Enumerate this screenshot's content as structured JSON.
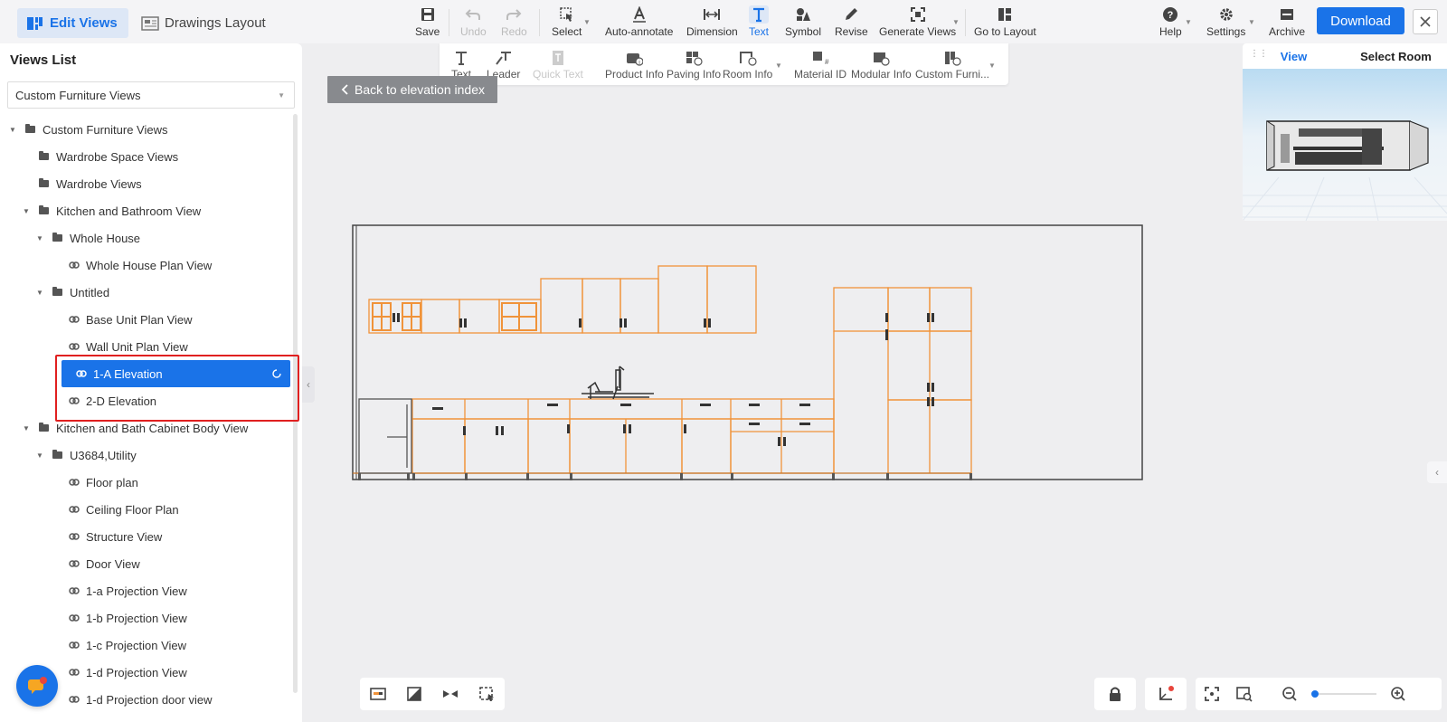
{
  "modes": [
    {
      "label": "Edit Views",
      "active": true
    },
    {
      "label": "Drawings Layout",
      "active": false
    }
  ],
  "toolbar": {
    "save": "Save",
    "undo": "Undo",
    "redo": "Redo",
    "select": "Select",
    "auto_annotate": "Auto-annotate",
    "dimension": "Dimension",
    "text": "Text",
    "symbol": "Symbol",
    "revise": "Revise",
    "generate_views": "Generate Views",
    "go_to_layout": "Go to Layout",
    "help": "Help",
    "settings": "Settings",
    "archive": "Archive",
    "download": "Download"
  },
  "subtoolbar": {
    "text": "Text",
    "leader": "Leader",
    "quick_text": "Quick Text",
    "product_info": "Product Info",
    "paving_info": "Paving Info",
    "room_info": "Room Info",
    "material_id": "Material ID",
    "modular_info": "Modular Info",
    "custom_furni": "Custom Furni..."
  },
  "views_panel": {
    "title": "Views List",
    "filter": "Custom Furniture Views",
    "tree": [
      {
        "label": "Custom Furniture Views",
        "level": 0,
        "type": "folder",
        "expanded": true
      },
      {
        "label": "Wardrobe Space Views",
        "level": 1,
        "type": "folder"
      },
      {
        "label": "Wardrobe Views",
        "level": 1,
        "type": "folder"
      },
      {
        "label": "Kitchen and Bathroom View",
        "level": 1,
        "type": "folder",
        "expanded": true
      },
      {
        "label": "Whole House",
        "level": 2,
        "type": "folder",
        "expanded": true
      },
      {
        "label": "Whole House Plan View",
        "level": 3,
        "type": "link"
      },
      {
        "label": "Untitled",
        "level": 2,
        "type": "folder",
        "expanded": true
      },
      {
        "label": "Base Unit Plan View",
        "level": 3,
        "type": "link"
      },
      {
        "label": "Wall Unit Plan View",
        "level": 3,
        "type": "link"
      },
      {
        "label": "1-A Elevation",
        "level": 3,
        "type": "link",
        "selected": true
      },
      {
        "label": "2-D Elevation",
        "level": 3,
        "type": "link"
      },
      {
        "label": "Kitchen and Bath Cabinet Body View",
        "level": 1,
        "type": "folder",
        "expanded": true
      },
      {
        "label": "U3684,Utility",
        "level": 2,
        "type": "folder",
        "expanded": true
      },
      {
        "label": "Floor plan",
        "level": 3,
        "type": "link"
      },
      {
        "label": "Ceiling Floor Plan",
        "level": 3,
        "type": "link"
      },
      {
        "label": "Structure View",
        "level": 3,
        "type": "link"
      },
      {
        "label": "Door View",
        "level": 3,
        "type": "link"
      },
      {
        "label": "1-a Projection View",
        "level": 3,
        "type": "link"
      },
      {
        "label": "1-b Projection View",
        "level": 3,
        "type": "link"
      },
      {
        "label": "1-c Projection View",
        "level": 3,
        "type": "link"
      },
      {
        "label": "1-d Projection View",
        "level": 3,
        "type": "link"
      },
      {
        "label": "1-d Projection door view",
        "level": 3,
        "type": "link"
      }
    ]
  },
  "back_button": "Back to elevation index",
  "preview": {
    "tabs": [
      "View",
      "Select Room"
    ]
  },
  "colors": {
    "accent": "#1a73e8",
    "cabinet_stroke": "#f0933a",
    "highlight": "#e02020"
  }
}
